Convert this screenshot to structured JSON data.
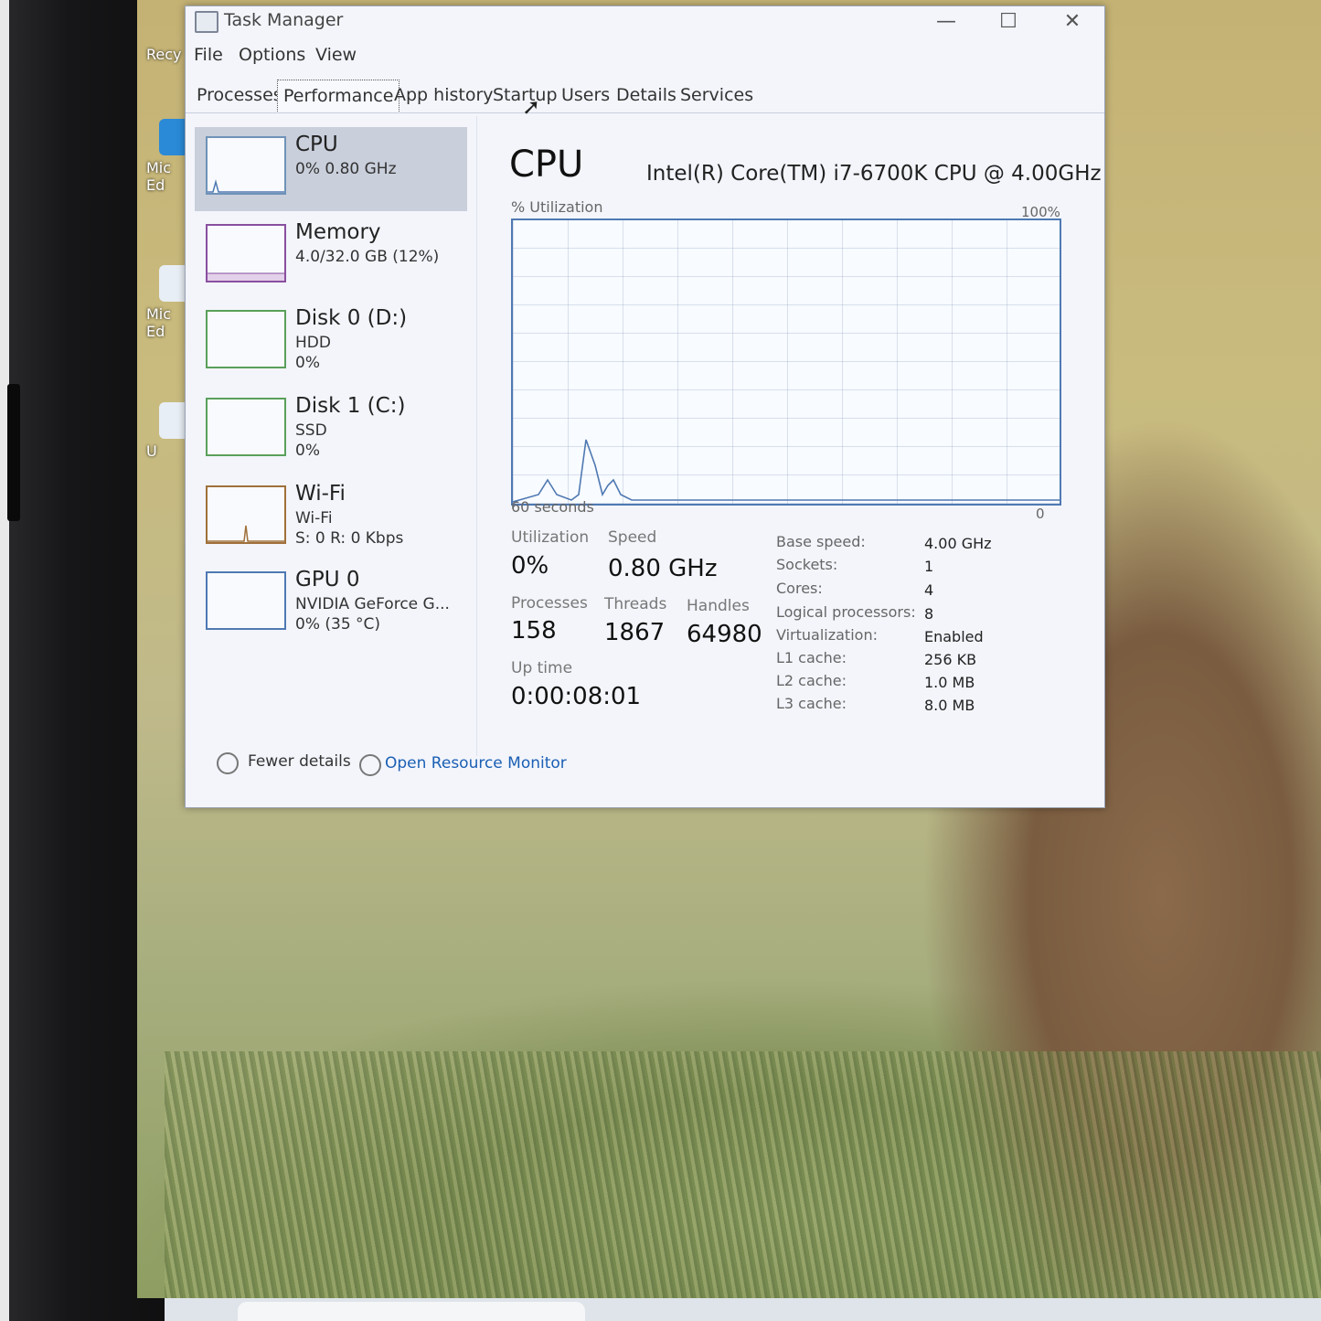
{
  "window": {
    "title": "Task Manager",
    "minimize": "—",
    "maximize": "☐",
    "close": "✕"
  },
  "menu": [
    "File",
    "Options",
    "View"
  ],
  "tabs": [
    "Processes",
    "Performance",
    "App history",
    "Startup",
    "Users",
    "Details",
    "Services"
  ],
  "active_tab": "Performance",
  "sidebar": [
    {
      "name": "CPU",
      "line2": "0% 0.80 GHz",
      "line3": ""
    },
    {
      "name": "Memory",
      "line2": "4.0/32.0 GB (12%)",
      "line3": ""
    },
    {
      "name": "Disk 0 (D:)",
      "line2": "HDD",
      "line3": "0%"
    },
    {
      "name": "Disk 1 (C:)",
      "line2": "SSD",
      "line3": "0%"
    },
    {
      "name": "Wi-Fi",
      "line2": "Wi-Fi",
      "line3": "S: 0 R: 0 Kbps"
    },
    {
      "name": "GPU 0",
      "line2": "NVIDIA GeForce G...",
      "line3": "0% (35 °C)"
    }
  ],
  "panel": {
    "title": "CPU",
    "model": "Intel(R) Core(TM) i7-6700K CPU @ 4.00GHz",
    "graph_label": "% Utilization",
    "graph_max": "100%",
    "graph_min": "0",
    "graph_span": "60 seconds",
    "stats": {
      "utilization_label": "Utilization",
      "utilization": "0%",
      "speed_label": "Speed",
      "speed": "0.80 GHz",
      "processes_label": "Processes",
      "processes": "158",
      "threads_label": "Threads",
      "threads": "1867",
      "handles_label": "Handles",
      "handles": "64980",
      "uptime_label": "Up time",
      "uptime": "0:00:08:01"
    },
    "specs": [
      {
        "label": "Base speed:",
        "value": "4.00 GHz"
      },
      {
        "label": "Sockets:",
        "value": "1"
      },
      {
        "label": "Cores:",
        "value": "4"
      },
      {
        "label": "Logical processors:",
        "value": "8"
      },
      {
        "label": "Virtualization:",
        "value": "Enabled"
      },
      {
        "label": "L1 cache:",
        "value": "256 KB"
      },
      {
        "label": "L2 cache:",
        "value": "1.0 MB"
      },
      {
        "label": "L3 cache:",
        "value": "8.0 MB"
      }
    ]
  },
  "footer": {
    "fewer_details": "Fewer details",
    "resource_monitor": "Open Resource Monitor"
  },
  "desktop_icons": [
    "Recy",
    "Mic Ed",
    "Mic Ed",
    "U"
  ],
  "colors": {
    "graph_line": "#4f79b2",
    "link": "#1a5fb4"
  }
}
